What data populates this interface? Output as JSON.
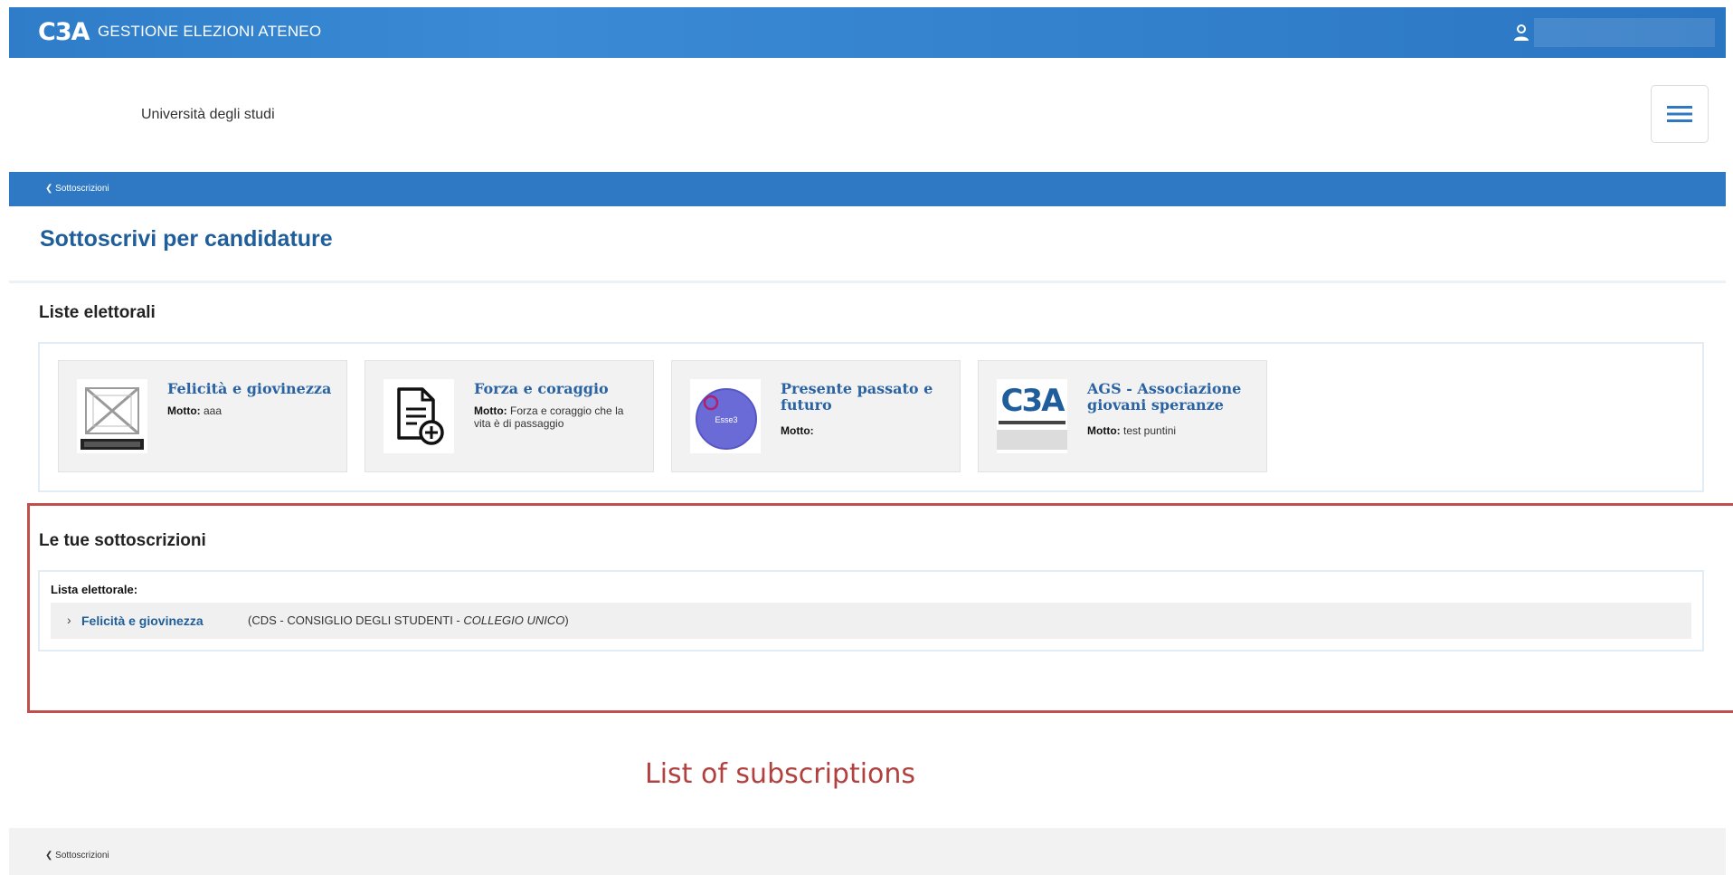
{
  "header": {
    "logo": "C3A",
    "title": "GESTIONE ELEZIONI ATENEO",
    "user_icon": "user-icon"
  },
  "university": {
    "name": "Università degli studi",
    "menu_icon": "hamburger-menu-icon"
  },
  "breadcrumb": {
    "back_label": "Sottoscrizioni"
  },
  "page": {
    "title": "Sottoscrivi per candidature"
  },
  "lists_section": {
    "title": "Liste elettorali",
    "cards": [
      {
        "name": "Felicità e giovinezza",
        "motto_label": "Motto:",
        "motto": "aaa",
        "image": "bicocca-logo"
      },
      {
        "name": "Forza e coraggio",
        "motto_label": "Motto:",
        "motto": "Forza e coraggio che la vita è di passaggio",
        "image": "document-add-icon"
      },
      {
        "name": "Presente passato e futuro",
        "motto_label": "Motto:",
        "motto": "",
        "image": "purple-circle-logo",
        "image_text": "Esse3"
      },
      {
        "name": "AGS - Associazione giovani speranze",
        "motto_label": "Motto:",
        "motto": "test puntini",
        "image": "c3a-logo",
        "image_text": "C3A"
      }
    ]
  },
  "subscriptions": {
    "title": "Le tue sottoscrizioni",
    "list_label": "Lista elettorale:",
    "items": [
      {
        "name": "Felicità e giovinezza",
        "detail_prefix": "(CDS - CONSIGLIO DEGLI STUDENTI - ",
        "detail_italic": "COLLEGIO UNICO",
        "detail_suffix": ")"
      }
    ]
  },
  "annotation": {
    "caption": "List of subscriptions",
    "color": "#c0504d"
  },
  "footer": {
    "back_label": "Sottoscrizioni"
  },
  "colors": {
    "primary": "#2e78c4",
    "title": "#1f5e9a",
    "accent_red": "#c0504d"
  }
}
